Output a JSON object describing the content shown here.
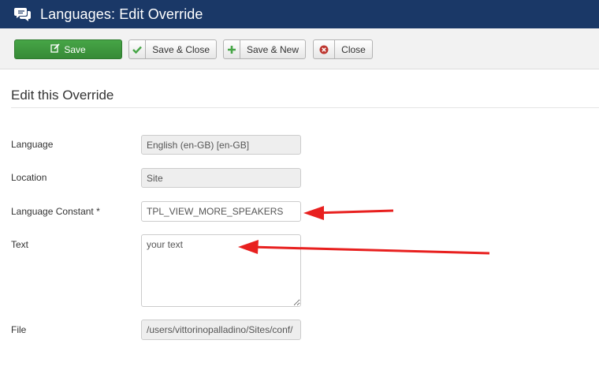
{
  "header": {
    "icon": "comments-icon",
    "title": "Languages: Edit Override",
    "bg_color": "#1a3867"
  },
  "toolbar": {
    "save_label": "Save",
    "save_close_label": "Save & Close",
    "save_new_label": "Save & New",
    "close_label": "Close",
    "accent_green": "#46a546",
    "close_icon_red": "#bd362f"
  },
  "form": {
    "heading": "Edit this Override",
    "language": {
      "label": "Language",
      "value": "English (en-GB) [en-GB]"
    },
    "location": {
      "label": "Location",
      "value": "Site"
    },
    "constant": {
      "label": "Language Constant *",
      "value": "TPL_VIEW_MORE_SPEAKERS"
    },
    "text": {
      "label": "Text",
      "value": "your text"
    },
    "file": {
      "label": "File",
      "value": "/users/vittorinopalladino/Sites/conf/"
    }
  },
  "annotations": {
    "arrow_color": "#e8201f"
  }
}
